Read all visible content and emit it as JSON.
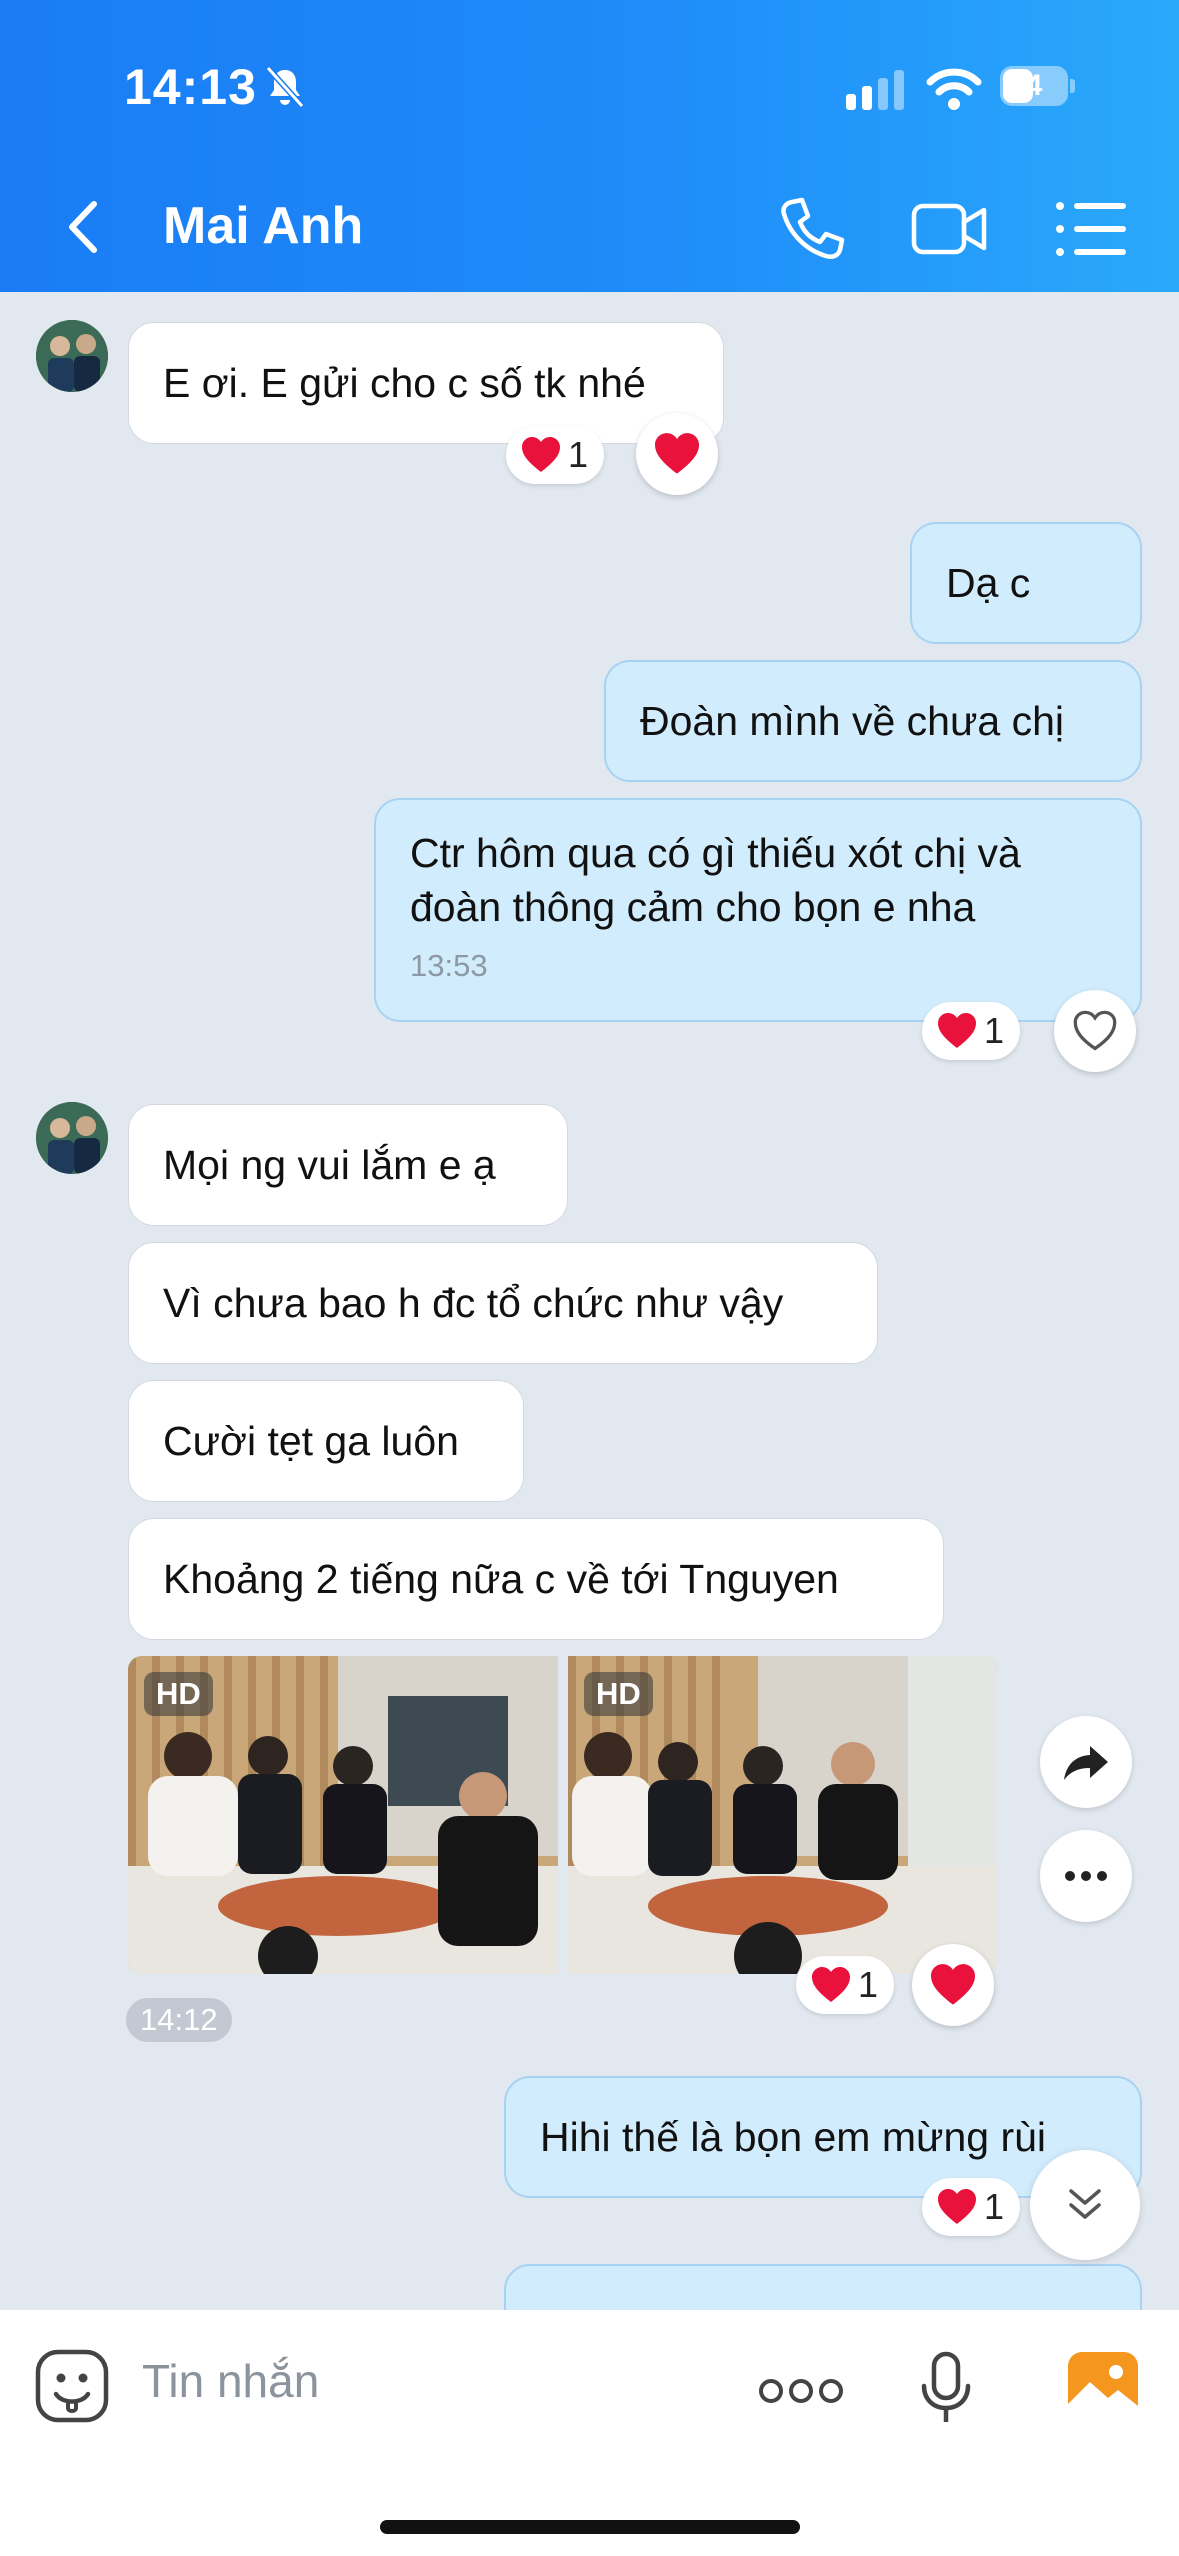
{
  "status_bar": {
    "time": "14:13",
    "battery": "4"
  },
  "header": {
    "contact_name": "Mai Anh"
  },
  "messages": {
    "m1": "E ơi. E gửi cho c số tk nhé",
    "m1_reaction_count": "1",
    "m2": "Dạ c",
    "m3": "Đoàn mình về chưa chị",
    "m4_line1": "Ctr hôm qua có gì thiếu xót chị và",
    "m4_line2": "đoàn thông cảm cho bọn e nha",
    "m4_time": "13:53",
    "m4_reaction_count": "1",
    "m5": "Mọi ng vui lắm e ạ",
    "m6": "Vì chưa bao h đc tổ chức như vậy",
    "m7": "Cười tẹt ga luôn",
    "m8": "Khoảng 2 tiếng nữa c về tới Tnguyen",
    "photo_badge": "HD",
    "photos_reaction_count": "1",
    "photos_time": "14:12",
    "m9": "Hihi thế là bọn em mừng rùi",
    "m9_reaction_count": "1"
  },
  "input": {
    "placeholder": "Tin nhắn"
  },
  "colors": {
    "header_blue": "#1e8cf9",
    "outgoing_bubble": "#d1ecfd",
    "heart": "#e8123c"
  }
}
